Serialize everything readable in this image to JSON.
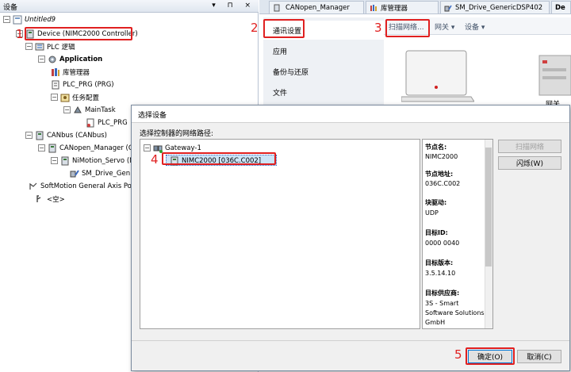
{
  "devices_panel": {
    "title": "设备",
    "header_buttons": "▾ ⊓ ×",
    "tree": [
      {
        "label": "Untitled9",
        "icon": "project-icon"
      },
      {
        "label": "Device (NIMC2000 Controller)",
        "icon": "device-icon"
      },
      {
        "label": "PLC 逻辑",
        "icon": "plc-logic-icon"
      },
      {
        "label": "Application",
        "icon": "application-gear-icon"
      },
      {
        "label": "库管理器",
        "icon": "library-manager-icon"
      },
      {
        "label": "PLC_PRG (PRG)",
        "icon": "program-icon"
      },
      {
        "label": "任务配置",
        "icon": "task-config-icon"
      },
      {
        "label": "MainTask",
        "icon": "task-icon"
      },
      {
        "label": "PLC_PRG",
        "icon": "program-call-icon"
      },
      {
        "label": "CANbus (CANbus)",
        "icon": "canbus-icon"
      },
      {
        "label": "CANopen_Manager (CAN",
        "icon": "canopen-manager-icon"
      },
      {
        "label": "NiMotion_Servo (NiM",
        "icon": "servo-icon"
      },
      {
        "label": "SM_Drive_Gen",
        "icon": "drive-icon"
      },
      {
        "label": "SoftMotion General Axis Poo",
        "icon": "axis-pool-icon"
      },
      {
        "label": "<空>",
        "icon": "empty-slot-icon"
      }
    ]
  },
  "editor_tabs": [
    {
      "label": "CANopen_Manager"
    },
    {
      "label": "库管理器"
    },
    {
      "label": "SM_Drive_GenericDSP402"
    },
    {
      "label": "De"
    }
  ],
  "side_menu": [
    "通讯设置",
    "应用",
    "备份与还原",
    "文件"
  ],
  "toolbar": {
    "scan": "扫描网络...",
    "gateway": "网关 ▾",
    "device": "设备 ▾"
  },
  "device_image_caption": "网关",
  "dialog": {
    "title": "选择设备",
    "path_label": "选择控制器的网络路径:",
    "gateway_node": "Gateway-1",
    "device_node": "NIMC2000 [036C.C002]",
    "info": [
      {
        "key": "节点名:",
        "value": [
          "NIMC2000"
        ]
      },
      {
        "key": "节点地址:",
        "value": [
          "036C.C002"
        ]
      },
      {
        "key": "块驱动:",
        "value": [
          "UDP"
        ]
      },
      {
        "key": "目标ID:",
        "value": [
          "0000 0040"
        ]
      },
      {
        "key": "目标版本:",
        "value": [
          "3.5.14.10"
        ]
      },
      {
        "key": "目标供应商:",
        "value": [
          "3S - Smart",
          "Software Solutions",
          "GmbH"
        ]
      }
    ],
    "scan_button": "扫描网络",
    "wink_button": "闪烁(W)",
    "ok_button": "确定(O)",
    "cancel_button": "取消(C)"
  },
  "annotations": [
    "1",
    "2",
    "3",
    "4",
    "5"
  ],
  "colors": {
    "annotation_red": "#e02020",
    "selection_blue": "#cce4f7"
  }
}
